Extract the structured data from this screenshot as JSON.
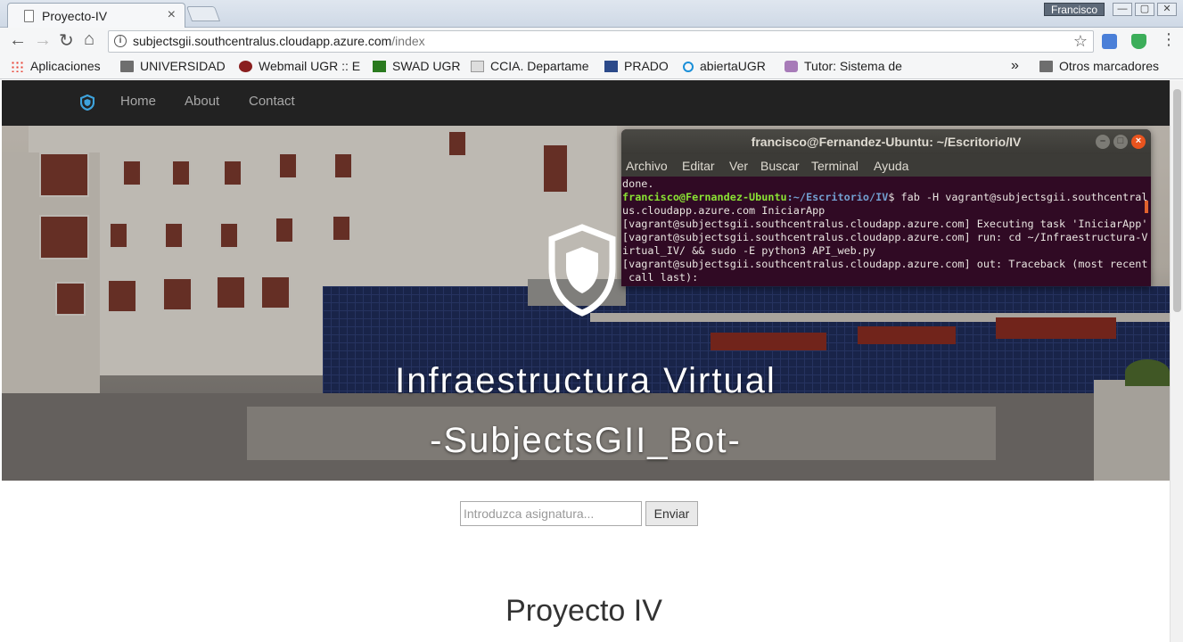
{
  "browser": {
    "tab_title": "Proyecto-IV",
    "tab_close": "×",
    "profile_name": "Francisco",
    "window_buttons": [
      "—",
      "▢",
      "✕"
    ],
    "url_host": "subjectsgii.southcentralus.cloudapp.azure.com",
    "url_path": "/index",
    "bookmarks": [
      {
        "label": "Aplicaciones",
        "icon": "apps-grid-icon"
      },
      {
        "label": "UNIVERSIDAD",
        "icon": "folder-icon"
      },
      {
        "label": "Webmail UGR :: E",
        "icon": "ugr-icon"
      },
      {
        "label": "SWAD UGR",
        "icon": "swad-icon"
      },
      {
        "label": "CCIA. Departame",
        "icon": "ccia-icon"
      },
      {
        "label": "PRADO",
        "icon": "prado-icon"
      },
      {
        "label": "abiertaUGR",
        "icon": "abierta-icon"
      },
      {
        "label": "Tutor: Sistema de",
        "icon": "tutor-icon"
      }
    ],
    "more_bookmarks": "»",
    "other_bookmarks": "Otros marcadores"
  },
  "site": {
    "nav": [
      "Home",
      "About",
      "Contact"
    ],
    "hero_title_1": "Infraestructura Virtual",
    "hero_title_2": "-SubjectsGII_Bot-",
    "search_placeholder": "Introduzca asignatura...",
    "send_label": "Enviar",
    "heading": "Proyecto IV"
  },
  "terminal": {
    "title": "francisco@Fernandez-Ubuntu: ~/Escritorio/IV",
    "menu": [
      "Archivo",
      "Editar",
      "Ver",
      "Buscar",
      "Terminal",
      "Ayuda"
    ],
    "line_done": "done.",
    "prompt_user": "francisco@Fernandez-Ubuntu",
    "prompt_path": ":~/Escritorio/IV",
    "command": "$ fab -H vagrant@subjectsgii.southcentral",
    "command_cont": "us.cloudapp.azure.com IniciarApp",
    "out_lines": [
      "[vagrant@subjectsgii.southcentralus.cloudapp.azure.com] Executing task 'IniciarApp'",
      "[vagrant@subjectsgii.southcentralus.cloudapp.azure.com] run: cd ~/Infraestructura-V",
      "irtual_IV/ && sudo -E python3 API_web.py",
      "[vagrant@subjectsgii.southcentralus.cloudapp.azure.com] out: Traceback (most recent",
      " call last):"
    ]
  }
}
